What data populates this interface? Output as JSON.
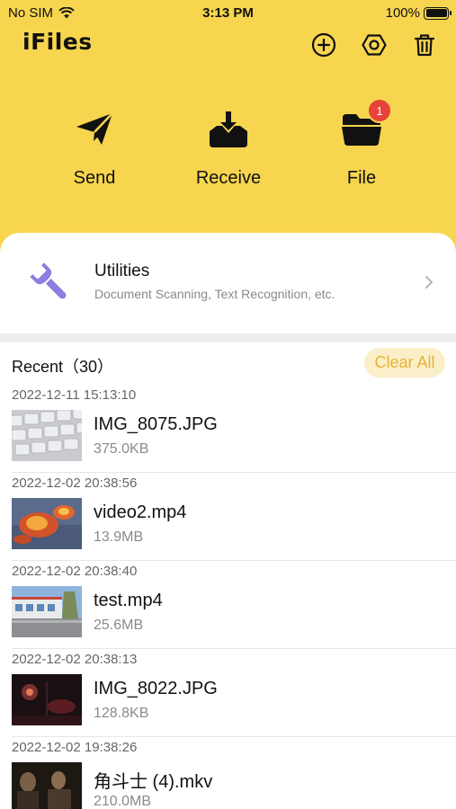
{
  "status": {
    "carrier": "No SIM",
    "time": "3:13 PM",
    "battery": "100%"
  },
  "app": {
    "title": "iFiles"
  },
  "header_icons": [
    "add-circle-icon",
    "settings-hexagon-icon",
    "trash-icon"
  ],
  "actions": [
    {
      "label": "Send",
      "icon": "paper-plane-icon"
    },
    {
      "label": "Receive",
      "icon": "inbox-download-icon"
    },
    {
      "label": "File",
      "icon": "folder-icon",
      "badge": "1"
    }
  ],
  "utilities": {
    "title": "Utilities",
    "subtitle": "Document Scanning, Text Recognition, etc.",
    "icon": "wrench-icon"
  },
  "recent": {
    "title": "Recent（30）",
    "clear_label": "Clear All",
    "items": [
      {
        "date": "2022-12-11 15:13:10",
        "name": "IMG_8075.JPG",
        "size": "375.0KB"
      },
      {
        "date": "2022-12-02 20:38:56",
        "name": "video2.mp4",
        "size": "13.9MB"
      },
      {
        "date": "2022-12-02 20:38:40",
        "name": "test.mp4",
        "size": "25.6MB"
      },
      {
        "date": "2022-12-02 20:38:13",
        "name": "IMG_8022.JPG",
        "size": "128.8KB"
      },
      {
        "date": "2022-12-02 19:38:26",
        "name": "角斗士 (4).mkv",
        "size": "210.0MB"
      }
    ]
  },
  "colors": {
    "header_bg": "#f7d54e",
    "accent": "#e7b235",
    "badge": "#e8423a",
    "icon_purple": "#8b7fe0"
  }
}
